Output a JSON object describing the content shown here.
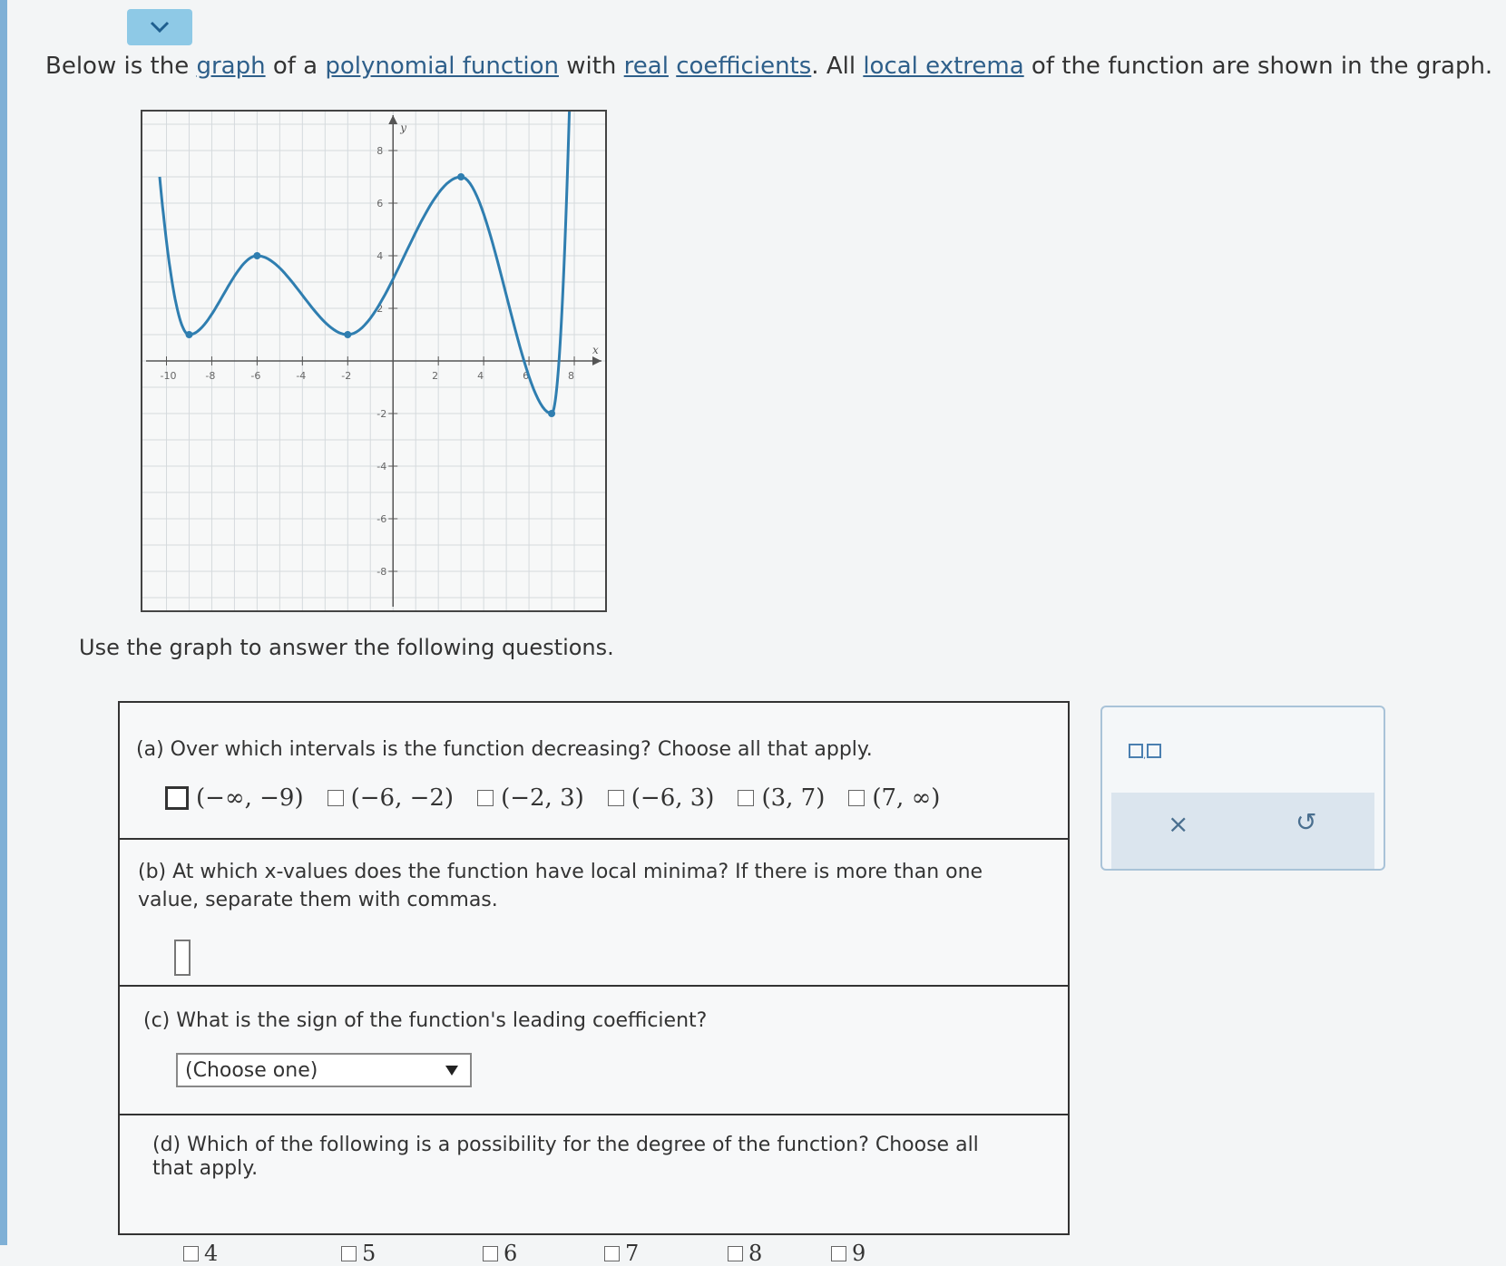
{
  "header": {
    "collapse_icon": "chevron-down-icon",
    "intro_parts": [
      {
        "text": "Below is the ",
        "vocab": false
      },
      {
        "text": "graph",
        "vocab": true
      },
      {
        "text": " of a ",
        "vocab": false
      },
      {
        "text": "polynomial function",
        "vocab": true
      },
      {
        "text": " with ",
        "vocab": false
      },
      {
        "text": "real",
        "vocab": true
      },
      {
        "text": " ",
        "vocab": false
      },
      {
        "text": "coefficients",
        "vocab": true
      },
      {
        "text": ". All ",
        "vocab": false
      },
      {
        "text": "local extrema",
        "vocab": true
      },
      {
        "text": " of the function are shown in the graph.",
        "vocab": false
      }
    ]
  },
  "graph": {
    "x_label": "x",
    "y_label": "y",
    "x_ticks": [
      "-10",
      "-8",
      "-6",
      "-4",
      "-2",
      "2",
      "4",
      "6",
      "8"
    ],
    "y_ticks": [
      "8",
      "6",
      "4",
      "2",
      "-2",
      "-4",
      "-6",
      "-8"
    ],
    "xlim": [
      -10,
      8
    ],
    "ylim": [
      -9,
      9
    ],
    "curve_color": "#2f7eb0",
    "extrema": [
      {
        "x": -9,
        "y": 1
      },
      {
        "x": -6,
        "y": 4
      },
      {
        "x": -2,
        "y": 1
      },
      {
        "x": 3,
        "y": 7
      },
      {
        "x": 7,
        "y": -2
      }
    ]
  },
  "prompt": "Use the graph to answer the following questions.",
  "questions": {
    "a": {
      "text": "(a) Over which intervals is the function decreasing? Choose all that apply.",
      "options": [
        "(−∞, −9)",
        "(−6, −2)",
        "(−2, 3)",
        "(−6, 3)",
        "(3, 7)",
        "(7, ∞)"
      ]
    },
    "b": {
      "text": "(b) At which x-values does the function have local minima? If there is more than one value, separate them with commas.",
      "value": ""
    },
    "c": {
      "text": "(c) What is the sign of the function's leading coefficient?",
      "selected": "(Choose one)"
    },
    "d": {
      "text": "(d) Which of the following is a possibility for the degree of the function? Choose all that apply.",
      "options": [
        "4",
        "5",
        "6",
        "7",
        "8",
        "9"
      ]
    }
  },
  "tools": {
    "fraction_icon": "ordered-pair-icon",
    "clear_label": "×",
    "undo_label": "↺"
  }
}
